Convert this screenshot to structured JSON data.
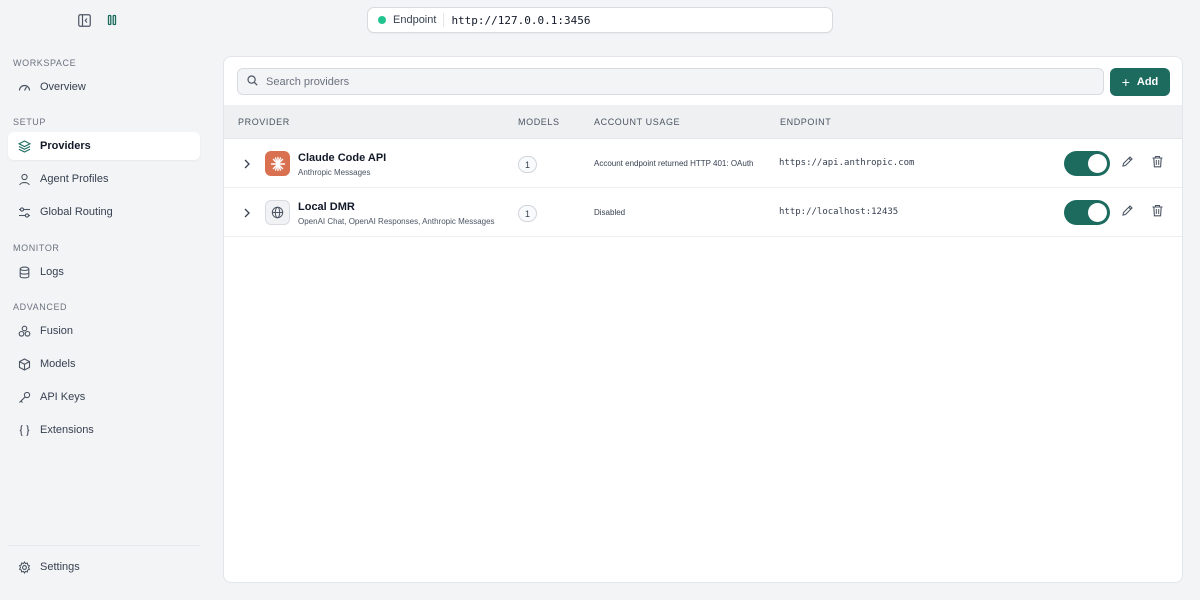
{
  "topbar": {
    "endpoint_label": "Endpoint",
    "endpoint_url": "http://127.0.0.1:3456",
    "status_color": "#22c38e"
  },
  "sidebar": {
    "sections": {
      "workspace": "WORKSPACE",
      "setup": "SETUP",
      "monitor": "MONITOR",
      "advanced": "ADVANCED"
    },
    "items": {
      "overview": "Overview",
      "providers": "Providers",
      "agent_profiles": "Agent Profiles",
      "global_routing": "Global Routing",
      "logs": "Logs",
      "fusion": "Fusion",
      "models": "Models",
      "api_keys": "API Keys",
      "extensions": "Extensions",
      "settings": "Settings"
    },
    "active": "providers"
  },
  "main": {
    "search_placeholder": "Search providers",
    "add_label": "Add",
    "accent_color": "#1d6b5f",
    "columns": {
      "provider": "PROVIDER",
      "models": "MODELS",
      "account_usage": "ACCOUNT USAGE",
      "endpoint": "ENDPOINT"
    },
    "rows": [
      {
        "name": "Claude Code API",
        "subtitle": "Anthropic Messages",
        "models": "1",
        "usage": "Account endpoint returned HTTP 401: OAuth",
        "endpoint": "https://api.anthropic.com",
        "enabled": true,
        "icon": "anthropic-burst-icon"
      },
      {
        "name": "Local DMR",
        "subtitle": "OpenAI Chat, OpenAI Responses, Anthropic Messages",
        "models": "1",
        "usage": "Disabled",
        "endpoint": "http://localhost:12435",
        "enabled": true,
        "icon": "globe-icon"
      }
    ]
  }
}
